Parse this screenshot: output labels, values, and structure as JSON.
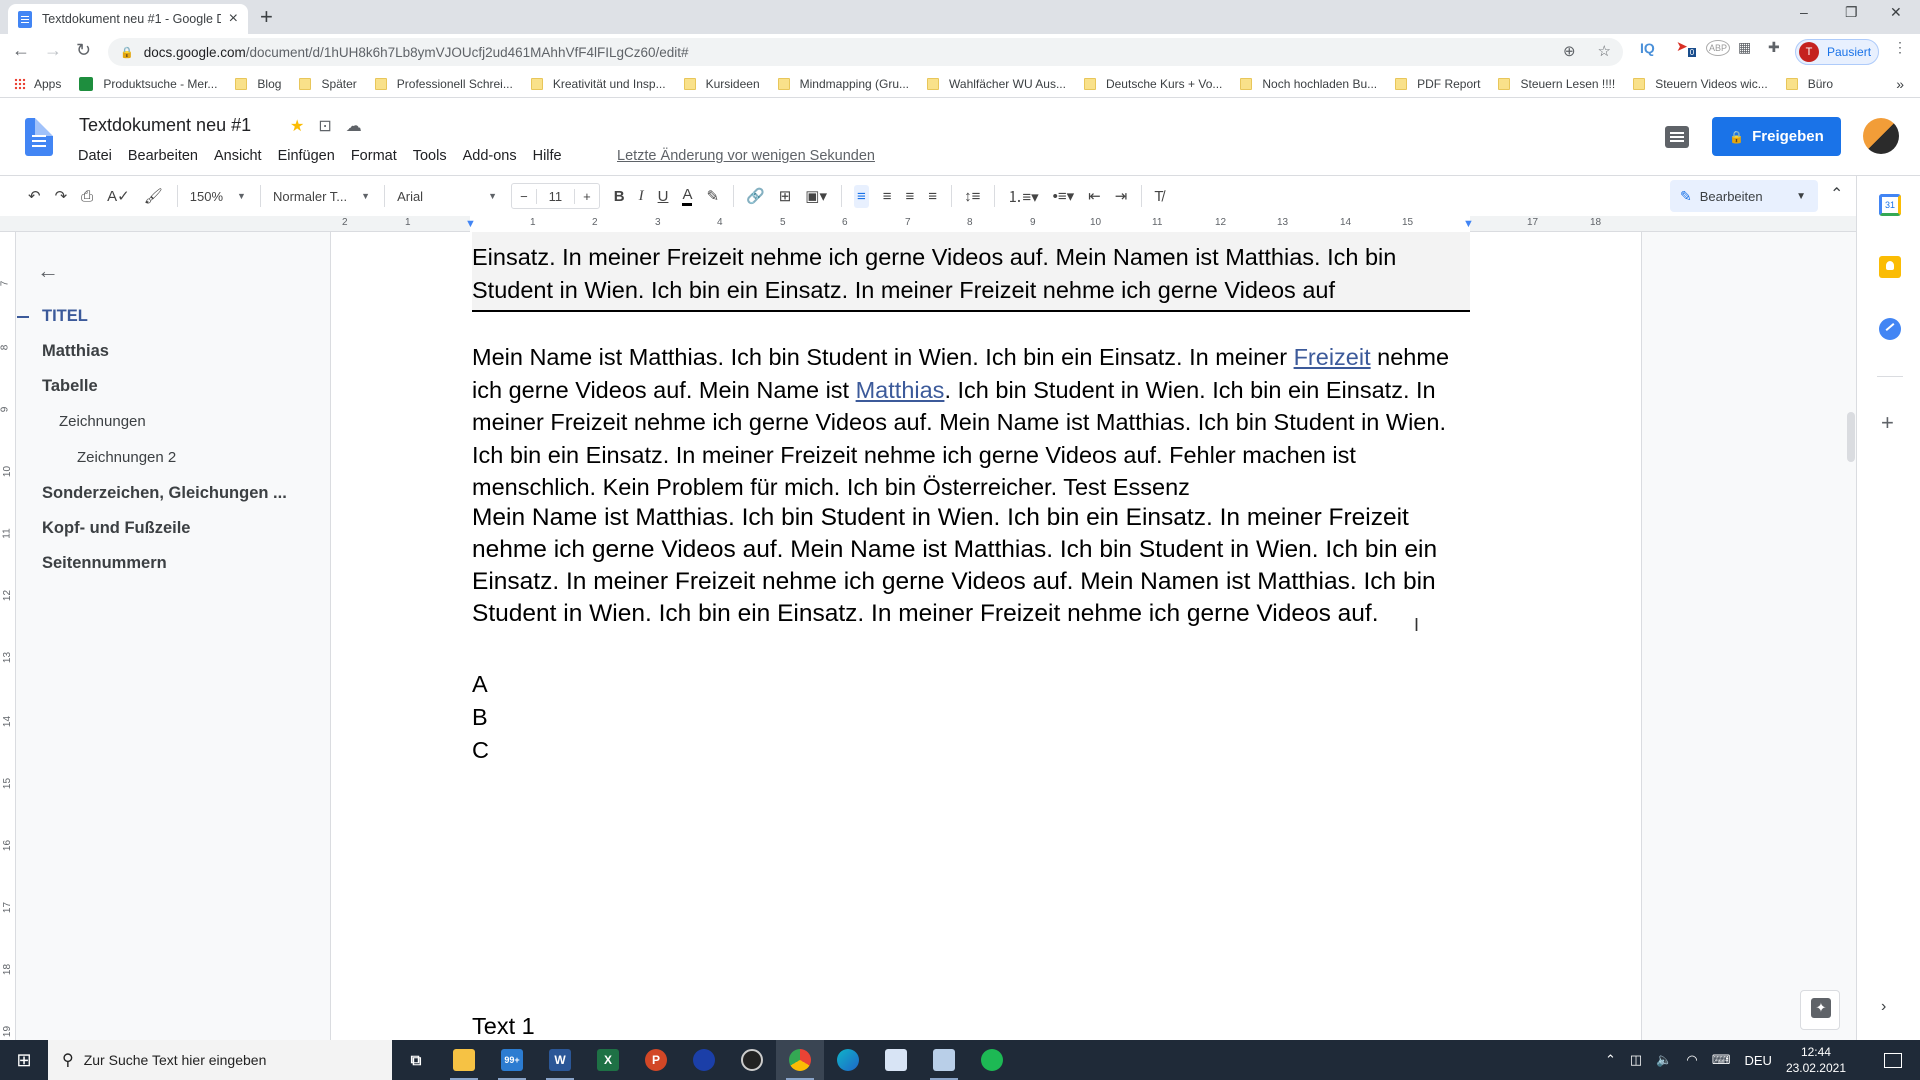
{
  "browser": {
    "tab_title": "Textdokument neu #1 - Google Docs",
    "tab_close": "×",
    "new_tab": "+",
    "window_controls": [
      "–",
      "❐",
      "✕"
    ],
    "url_host": "docs.google.com",
    "url_path": "/document/d/1hUH8k6h7Lb8ymVJOUcfj2ud461MAhhVfF4lFILgCz60/edit#",
    "profile_initial": "T",
    "profile_status": "Pausiert",
    "extensions": [
      "zoom-icon",
      "star-icon",
      "iq-icon",
      "extension-badge-icon",
      "abp-icon",
      "extension-grid-icon",
      "puzzle-icon"
    ],
    "extension_badge_count": "0",
    "abp_label": "ABP",
    "iq_label": "IQ",
    "bookmarks": [
      {
        "label": "Apps",
        "type": "apps"
      },
      {
        "label": "Produktsuche - Mer...",
        "type": "site"
      },
      {
        "label": "Blog",
        "type": "folder"
      },
      {
        "label": "Später",
        "type": "folder"
      },
      {
        "label": "Professionell Schrei...",
        "type": "folder"
      },
      {
        "label": "Kreativität und Insp...",
        "type": "folder"
      },
      {
        "label": "Kursideen",
        "type": "folder"
      },
      {
        "label": "Mindmapping  (Gru...",
        "type": "folder"
      },
      {
        "label": "Wahlfächer WU Aus...",
        "type": "folder"
      },
      {
        "label": "Deutsche Kurs + Vo...",
        "type": "folder"
      },
      {
        "label": "Noch hochladen Bu...",
        "type": "folder"
      },
      {
        "label": "PDF Report",
        "type": "folder"
      },
      {
        "label": "Steuern Lesen !!!!",
        "type": "folder"
      },
      {
        "label": "Steuern Videos wic...",
        "type": "folder"
      },
      {
        "label": "Büro",
        "type": "folder"
      }
    ],
    "bookmarks_overflow": "»"
  },
  "docs": {
    "title": "Textdokument neu #1",
    "menu": [
      "Datei",
      "Bearbeiten",
      "Ansicht",
      "Einfügen",
      "Format",
      "Tools",
      "Add-ons",
      "Hilfe"
    ],
    "last_edit": "Letzte Änderung vor wenigen Sekunden",
    "share_label": "Freigeben",
    "toolbar": {
      "zoom": "150%",
      "style": "Normaler T...",
      "font": "Arial",
      "font_size": "11",
      "minus": "−",
      "plus": "+",
      "bold": "B",
      "italic": "I",
      "underline": "U",
      "text_color": "A",
      "edit_mode": "Bearbeiten"
    },
    "ruler_ticks": [
      "2",
      "1",
      "1",
      "2",
      "3",
      "4",
      "5",
      "6",
      "7",
      "8",
      "9",
      "10",
      "11",
      "12",
      "13",
      "14",
      "15",
      "16",
      "17",
      "18"
    ],
    "vruler_ticks": [
      "7",
      "8",
      "9",
      "10",
      "11",
      "12",
      "13",
      "14",
      "15",
      "16",
      "17",
      "18",
      "19"
    ]
  },
  "outline": {
    "items": [
      {
        "label": "TITEL",
        "level": 1,
        "active": true
      },
      {
        "label": "Matthias",
        "level": 1
      },
      {
        "label": "Tabelle",
        "level": 1
      },
      {
        "label": "Zeichnungen",
        "level": 2
      },
      {
        "label": "Zeichnungen 2",
        "level": 3
      },
      {
        "label": "Sonderzeichen, Gleichungen ...",
        "level": 1
      },
      {
        "label": "Kopf- und Fußzeile",
        "level": 1
      },
      {
        "label": "Seitennummern",
        "level": 1
      }
    ]
  },
  "document": {
    "prev_block": [
      "Einsatz. In meiner Freizeit nehme ich gerne Videos auf. Mein Namen ist Matthias. Ich bin",
      "Student in Wien. Ich bin ein Einsatz. In meiner Freizeit nehme ich gerne Videos auf"
    ],
    "para1": {
      "p1": "Mein Name ist Matthias. Ich bin Student in Wien. Ich bin ein Einsatz. In meiner ",
      "link1": "Freizeit",
      "p2": " nehme ich gerne Videos auf. Mein Name ist ",
      "link2": "Matthias",
      "p3": ". Ich bin Student in Wien. Ich bin ein Einsatz. In meiner Freizeit nehme ich gerne Videos auf. Mein Name ist Matthias. Ich bin Student in Wien. Ich bin ein Einsatz. In meiner Freizeit nehme ich gerne Videos auf. Fehler machen ist menschlich. Kein Problem für mich. Ich bin Österreicher. Test Essenz"
    },
    "para2": "Mein Name ist Matthias. Ich bin Student in Wien. Ich bin ein Einsatz. In meiner Freizeit nehme ich gerne Videos auf. Mein Name ist Matthias. Ich bin Student in Wien. Ich bin ein Einsatz. In meiner Freizeit nehme ich gerne Videos auf. Mein Namen ist Matthias. Ich bin Student in Wien. Ich bin ein Einsatz. In meiner Freizeit nehme ich gerne Videos auf.",
    "list": [
      "A",
      "B",
      "C"
    ],
    "footer_text": "Text 1"
  },
  "taskbar": {
    "search_placeholder": "Zur Suche Text hier eingeben",
    "mail_badge": "99+",
    "language": "DEU",
    "time": "12:44",
    "date": "23.02.2021"
  },
  "colors": {
    "accent": "#1a73e8",
    "link": "#3c5a9a",
    "taskbar": "#1f2a38"
  }
}
